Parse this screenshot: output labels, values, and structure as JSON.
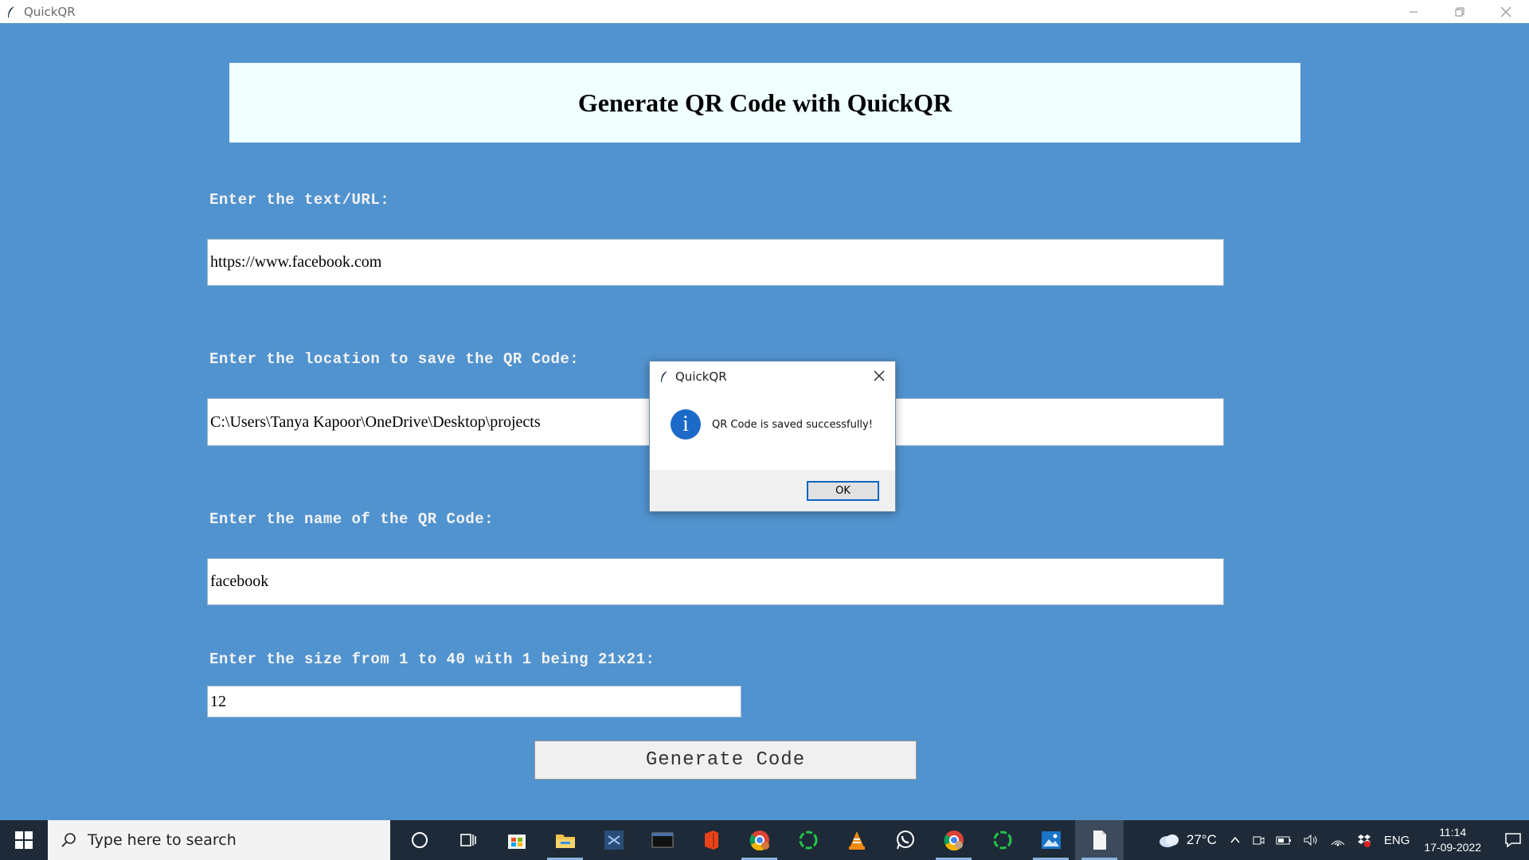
{
  "window": {
    "title": "QuickQR",
    "controls": [
      "minimize",
      "restore",
      "close"
    ]
  },
  "header": {
    "title": "Generate QR Code with QuickQR"
  },
  "form": {
    "text_label": "Enter the text/URL:",
    "text_value": "https://www.facebook.com",
    "location_label": "Enter the location to save the QR Code:",
    "location_value": "C:\\Users\\Tanya Kapoor\\OneDrive\\Desktop\\projects",
    "name_label": "Enter the name of the QR Code:",
    "name_value": "facebook",
    "size_label": "Enter the size from 1 to 40 with 1 being 21x21:",
    "size_value": "12",
    "generate_label": "Generate Code"
  },
  "dialog": {
    "title": "QuickQR",
    "message": "QR Code is saved successfully!",
    "ok_label": "OK",
    "icon": "info-icon"
  },
  "taskbar": {
    "search_placeholder": "Type here to search",
    "apps": [
      {
        "name": "cortana-icon"
      },
      {
        "name": "task-view-icon"
      },
      {
        "name": "store-icon"
      },
      {
        "name": "file-explorer-icon"
      },
      {
        "name": "visual-studio-icon"
      },
      {
        "name": "mysql-icon"
      },
      {
        "name": "office-icon"
      },
      {
        "name": "chrome-profile-icon"
      },
      {
        "name": "loader-app-icon"
      },
      {
        "name": "vlc-icon"
      },
      {
        "name": "whatsapp-icon"
      },
      {
        "name": "chrome-icon"
      },
      {
        "name": "loader-app-2-icon"
      },
      {
        "name": "photos-icon"
      },
      {
        "name": "blank-document-icon"
      }
    ],
    "weather": "27°C",
    "language": "ENG",
    "time": "11:14",
    "date": "17-09-2022"
  },
  "colors": {
    "background": "#5193cf",
    "header_panel": "#f0ffff",
    "taskbar": "#1e2a38",
    "accent": "#0a66c2"
  }
}
